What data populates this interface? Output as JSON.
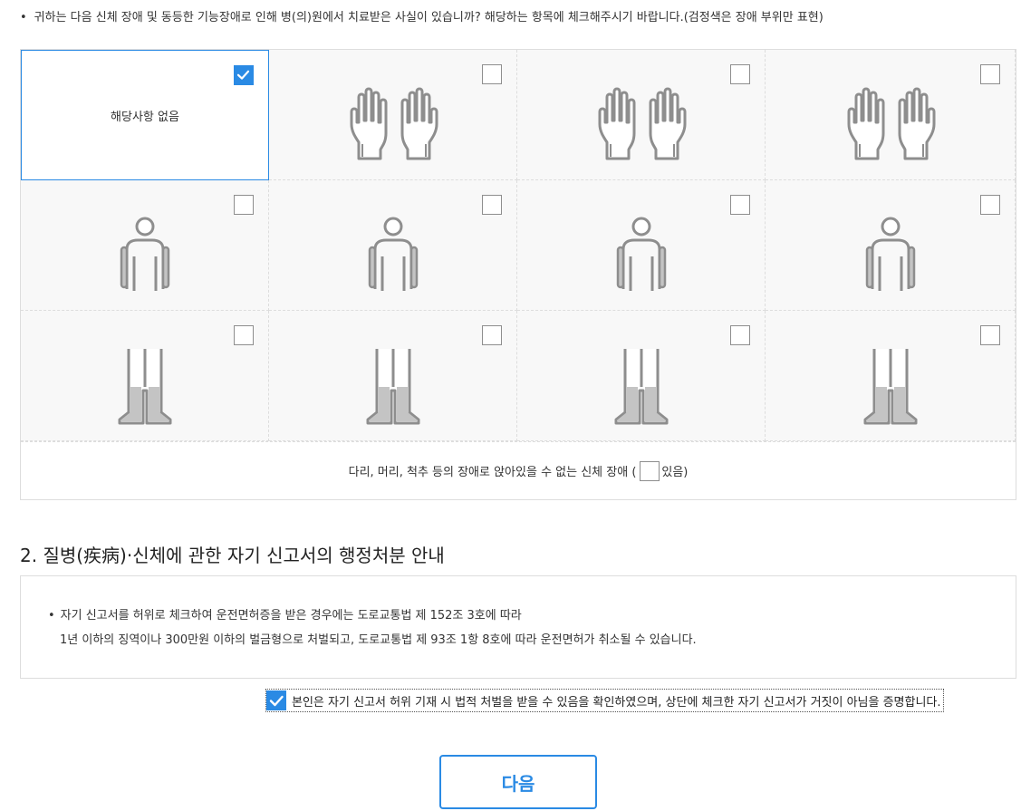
{
  "intro": {
    "bullet": "•",
    "text": "귀하는 다음 신체 장애 및 동등한 기능장애로 인해 병(의)원에서 치료받은 사실이 있습니까? 해당하는 항목에 체크해주시기 바랍니다.(검정색은 장애 부위만 표현)"
  },
  "grid": {
    "none_label": "해당사항 없음",
    "cells": [
      {
        "kind": "none",
        "checked": true,
        "icon": "none"
      },
      {
        "kind": "hands",
        "checked": false,
        "icon": "hands-icon"
      },
      {
        "kind": "hands",
        "checked": false,
        "icon": "hands-icon"
      },
      {
        "kind": "hands",
        "checked": false,
        "icon": "hands-icon"
      },
      {
        "kind": "body",
        "checked": false,
        "icon": "upper-body-icon"
      },
      {
        "kind": "body",
        "checked": false,
        "icon": "upper-body-icon"
      },
      {
        "kind": "body",
        "checked": false,
        "icon": "upper-body-icon"
      },
      {
        "kind": "body",
        "checked": false,
        "icon": "upper-body-icon"
      },
      {
        "kind": "legs",
        "checked": false,
        "icon": "legs-icon"
      },
      {
        "kind": "legs",
        "checked": false,
        "icon": "legs-icon"
      },
      {
        "kind": "legs",
        "checked": false,
        "icon": "legs-icon"
      },
      {
        "kind": "legs",
        "checked": false,
        "icon": "legs-icon"
      }
    ],
    "bottom_before": "다리, 머리, 척추 등의 장애로 앉아있을 수 없는 신체 장애 (",
    "bottom_after": "있음)"
  },
  "section": {
    "title": "2. 질병(疾病)·신체에 관한 자기 신고서의 행정처분 안내"
  },
  "notice": {
    "bullet": "•",
    "line1": "자기 신고서를 허위로 체크하여 운전면허증을 받은 경우에는 도로교통법 제 152조 3호에 따라",
    "line2": "1년 이하의 징역이나 300만원 이하의 벌금형으로 처벌되고, 도로교통법 제 93조 1항 8호에 따라 운전면허가 취소될 수 있습니다."
  },
  "confirm": {
    "checked": true,
    "text": "본인은 자기 신고서 허위 기재 시 법적 처벌을 받을 수 있음을 확인하였으며, 상단에 체크한 자기 신고서가 거짓이 아님을 증명합니다."
  },
  "next_button": {
    "label": "다음"
  },
  "colors": {
    "accent": "#2a8ae4",
    "icon_stroke": "#8e8e8e",
    "icon_fill": "#c4c4c4"
  }
}
